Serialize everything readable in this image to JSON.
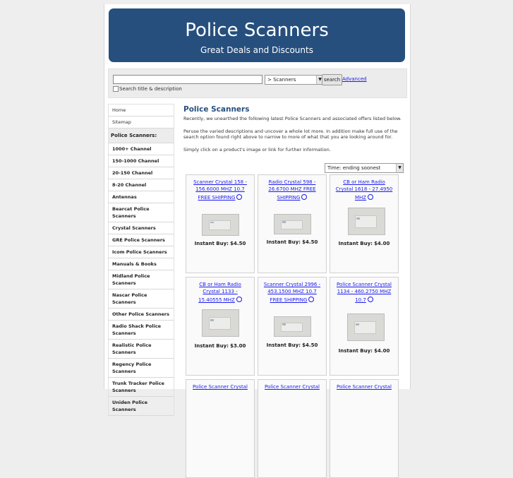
{
  "banner": {
    "title": "Police Scanners",
    "subtitle": "Great Deals and Discounts"
  },
  "search": {
    "input_value": "",
    "category_selected": "> Scanners",
    "button_label": "search",
    "advanced_label": "Advanced",
    "checkbox_label": "Search title & description"
  },
  "sidebar": {
    "items": [
      "Home",
      "Sitemap"
    ],
    "heading": "Police Scanners:",
    "categories": [
      "1000+ Channel",
      "150-1000 Channel",
      "20-150 Channel",
      "8-20 Channel",
      "Antennas",
      "Bearcat Police Scanners",
      "Crystal Scanners",
      "GRE Police Scanners",
      "Icom Police Scanners",
      "Manuals & Books",
      "Midland Police Scanners",
      "Nascar Police Scanners",
      "Other Police Scanners",
      "Radio Shack Police Scanners",
      "Realistic Police Scanners",
      "Regency Police Scanners",
      "Trunk Tracker Police Scanners",
      "Uniden Police Scanners"
    ]
  },
  "main": {
    "title": "Police Scanners",
    "intro": "Recently, we unearthed the following latest Police Scanners and associated offers listed below.",
    "para2": "Peruse the varied descriptions and uncover a whole lot more. In addition make full use of the search option found right above to narrow to more of what that you are looking around for.",
    "para3": "Simply click on a product's image or link for further information.",
    "sort_selected": "Time: ending soonest"
  },
  "products": [
    {
      "title": "Scanner Crystal 158 - 156.6000 MHZ 10.7 FREE SHIPPING",
      "price_label": "Instant Buy:",
      "price": "$4.50"
    },
    {
      "title": "Radio Crystal 598 - 26.6700 MHZ FREE SHIPPING",
      "price_label": "Instant Buy:",
      "price": "$4.50"
    },
    {
      "title": "CB or Ham Radio Crystal 1618 - 27.4950 MHZ",
      "price_label": "Instant Buy:",
      "price": "$4.00"
    },
    {
      "title": "CB or Ham Radio Crystal 1133 - 15.40555 MHZ",
      "price_label": "Instant Buy:",
      "price": "$3.00"
    },
    {
      "title": "Scanner Crystal 2996 - 453.1500 MHZ 10.7 FREE SHIPPING",
      "price_label": "Instant Buy:",
      "price": "$4.50"
    },
    {
      "title": "Police Scanner Crystal 1134 - 460.2750 MHZ 10.7",
      "price_label": "Instant Buy:",
      "price": "$4.00"
    },
    {
      "title": "Police Scanner Crystal",
      "price_label": "",
      "price": ""
    },
    {
      "title": "Police Scanner Crystal",
      "price_label": "",
      "price": ""
    },
    {
      "title": "Police Scanner Crystal",
      "price_label": "",
      "price": ""
    }
  ]
}
